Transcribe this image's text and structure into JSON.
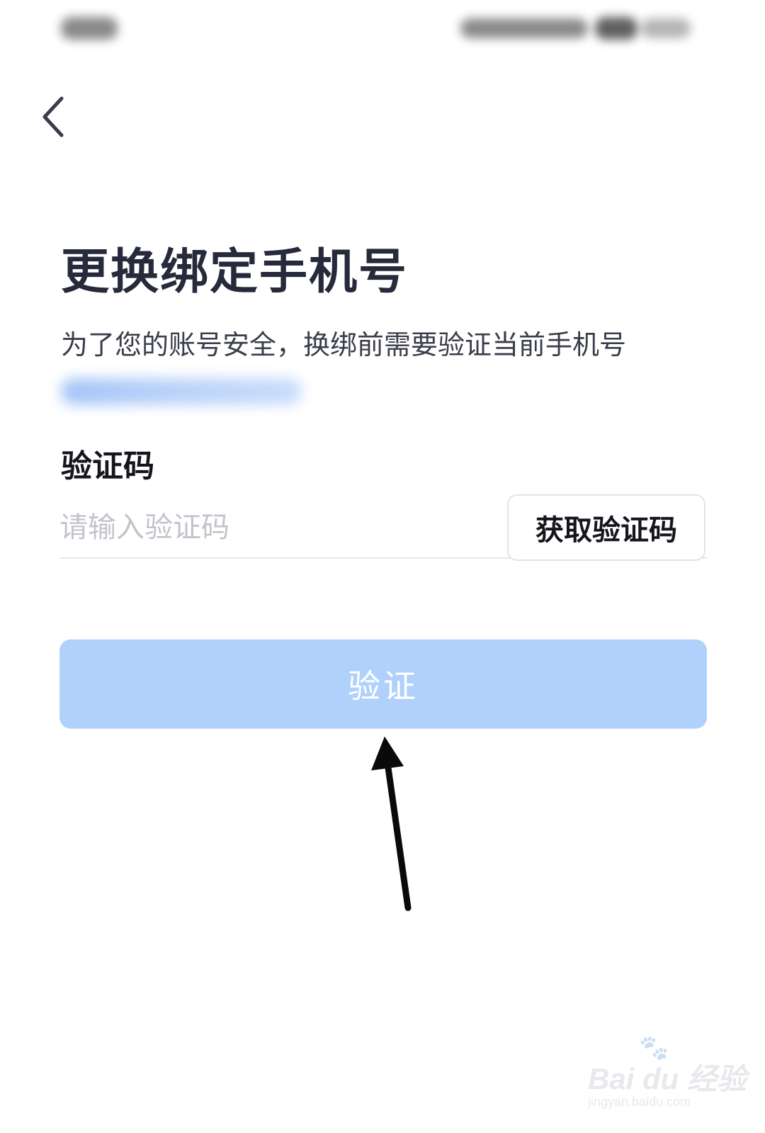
{
  "page": {
    "title": "更换绑定手机号",
    "subtitle": "为了您的账号安全，换绑前需要验证当前手机号"
  },
  "form": {
    "code_label": "验证码",
    "code_placeholder": "请输入验证码",
    "get_code_label": "获取验证码",
    "verify_label": "验证"
  },
  "watermark": {
    "logo_text": "Bai du 经验",
    "url": "jingyan.baidu.com"
  },
  "colors": {
    "title": "#262a3a",
    "verify_button_disabled": "#b0d1fb",
    "masked_phone_tint": "#8fb6f5"
  },
  "icons": {
    "back": "chevron-left-icon",
    "annotation": "arrow-up-annotation"
  }
}
